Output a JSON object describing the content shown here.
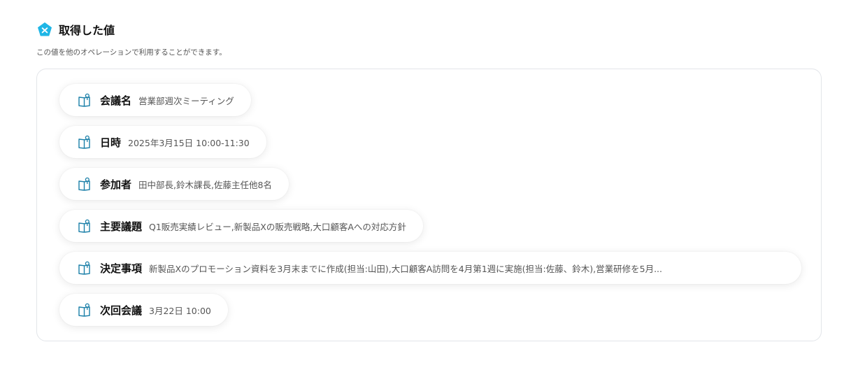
{
  "header": {
    "title": "取得した値",
    "subtitle": "この値を他のオペレーションで利用することができます。",
    "icon": "pentagon-x-icon",
    "accent": "#1fb6e6"
  },
  "items": [
    {
      "label": "会議名",
      "value": "営業部週次ミーティング",
      "icon": "book-pin-icon"
    },
    {
      "label": "日時",
      "value": "2025年3月15日 10:00-11:30",
      "icon": "book-pin-icon"
    },
    {
      "label": "参加者",
      "value": "田中部長,鈴木課長,佐藤主任他8名",
      "icon": "book-pin-icon"
    },
    {
      "label": "主要議題",
      "value": "Q1販売実績レビュー,新製品Xの販売戦略,大口顧客Aへの対応方針",
      "icon": "book-pin-icon"
    },
    {
      "label": "決定事項",
      "value": "新製品Xのプロモーション資料を3月末までに作成(担当:山田),大口顧客A訪問を4月第1週に実施(担当:佐藤、鈴木),営業研修を5月...",
      "icon": "book-pin-icon"
    },
    {
      "label": "次回会議",
      "value": "3月22日 10:00",
      "icon": "book-pin-icon"
    }
  ]
}
